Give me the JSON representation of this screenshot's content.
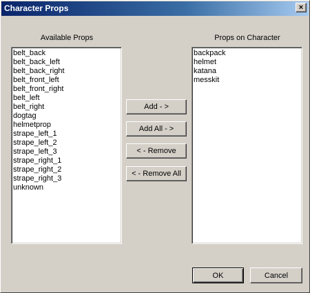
{
  "window": {
    "title": "Character Props",
    "close_glyph": "×"
  },
  "available": {
    "label": "Available Props",
    "items": [
      "belt_back",
      "belt_back_left",
      "belt_back_right",
      "belt_front_left",
      "belt_front_right",
      "belt_left",
      "belt_right",
      "dogtag",
      "helmetprop",
      "strape_left_1",
      "strape_left_2",
      "strape_left_3",
      "strape_right_1",
      "strape_right_2",
      "strape_right_3",
      "unknown"
    ]
  },
  "on_character": {
    "label": "Props on Character",
    "items": [
      "backpack",
      "helmet",
      "katana",
      "messkit"
    ]
  },
  "buttons": {
    "add": "Add - >",
    "add_all": "Add All - >",
    "remove": "< - Remove",
    "remove_all": "< - Remove All",
    "ok": "OK",
    "cancel": "Cancel"
  }
}
